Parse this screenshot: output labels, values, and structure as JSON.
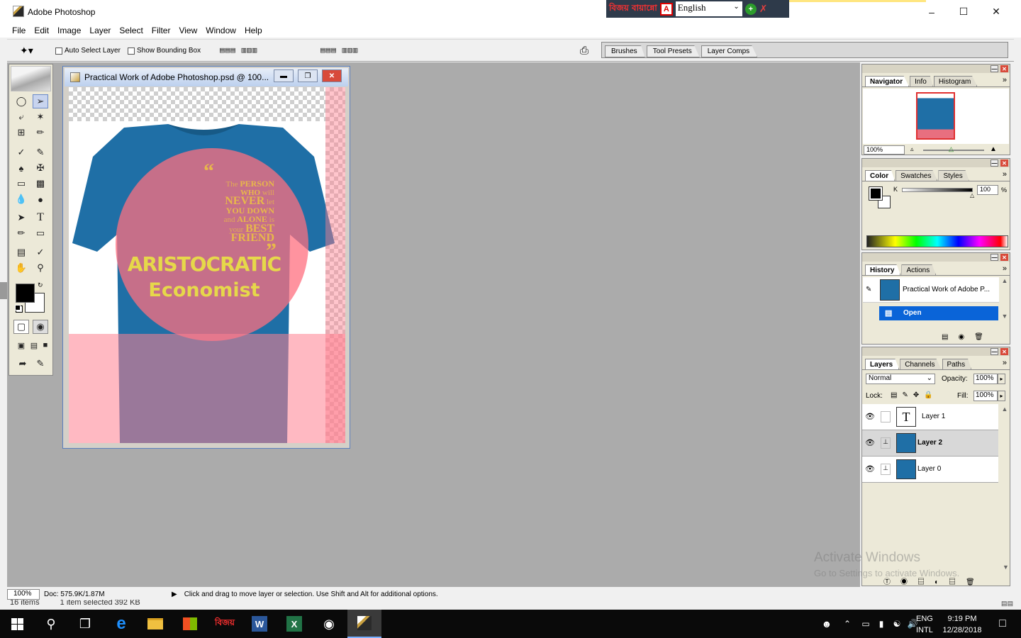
{
  "window": {
    "title": "Adobe Photoshop",
    "minimize_icon": "minimize-icon",
    "maximize_icon": "maximize-icon",
    "close_icon": "close-icon"
  },
  "ime": {
    "bangla_label": "বায়ান্নো",
    "language": "English"
  },
  "menu": [
    "File",
    "Edit",
    "Image",
    "Layer",
    "Select",
    "Filter",
    "View",
    "Window",
    "Help"
  ],
  "options": {
    "auto_select": "Auto Select Layer",
    "bounding_box": "Show Bounding Box"
  },
  "palette_well": [
    "Brushes",
    "Tool Presets",
    "Layer Comps"
  ],
  "document": {
    "title": "Practical Work of Adobe Photoshop.psd @ 100...",
    "quote_open": "“",
    "quote_lines": [
      {
        "a": "The ",
        "b": "PERSON"
      },
      {
        "a": "",
        "b": "WHO",
        "c": " will"
      },
      {
        "a": "",
        "b": "NEVER",
        "c": " let"
      },
      {
        "a": "",
        "b": "YOU DOWN"
      },
      {
        "a": "and ",
        "b": "ALONE",
        "c": " is"
      },
      {
        "a": "your ",
        "b": "BEST"
      },
      {
        "a": "",
        "b": "FRIEND"
      }
    ],
    "quote_close": "”",
    "brand_line1": "ARISTOCRATIC",
    "brand_line2": "Economist"
  },
  "navigator": {
    "tabs": [
      "Navigator",
      "Info",
      "Histogram"
    ],
    "zoom": "100%"
  },
  "color": {
    "tabs": [
      "Color",
      "Swatches",
      "Styles"
    ],
    "channel": "K",
    "value": "100",
    "unit": "%"
  },
  "history": {
    "tabs": [
      "History",
      "Actions"
    ],
    "snapshot": "Practical Work of Adobe P...",
    "step": "Open"
  },
  "layers": {
    "tabs": [
      "Layers",
      "Channels",
      "Paths"
    ],
    "blend_mode": "Normal",
    "opacity_label": "Opacity:",
    "opacity": "100%",
    "lock_label": "Lock:",
    "fill_label": "Fill:",
    "fill": "100%",
    "items": [
      {
        "name": "Layer 1"
      },
      {
        "name": "Layer 2"
      },
      {
        "name": "Layer 0"
      }
    ]
  },
  "status": {
    "zoom": "100%",
    "doc": "Doc: 575.9K/1.87M",
    "hint": "Click and drag to move layer or selection.  Use Shift and Alt for additional options."
  },
  "explorer_status": {
    "items": "16 items",
    "selected": "1 item selected  392 KB"
  },
  "watermark": {
    "line1": "Activate Windows",
    "line2": "Go to Settings to activate Windows."
  },
  "taskbar": {
    "lang1": "ENG",
    "lang2": "INTL",
    "time": "9:19 PM",
    "date": "12/28/2018"
  },
  "colors": {
    "shirt_blue": "#1f6fa6",
    "pink_overlay": "#ff6f7f",
    "gold_text": "#e8b84a",
    "yellow_text": "#e6d84a",
    "selected_blue": "#0a64d8"
  }
}
